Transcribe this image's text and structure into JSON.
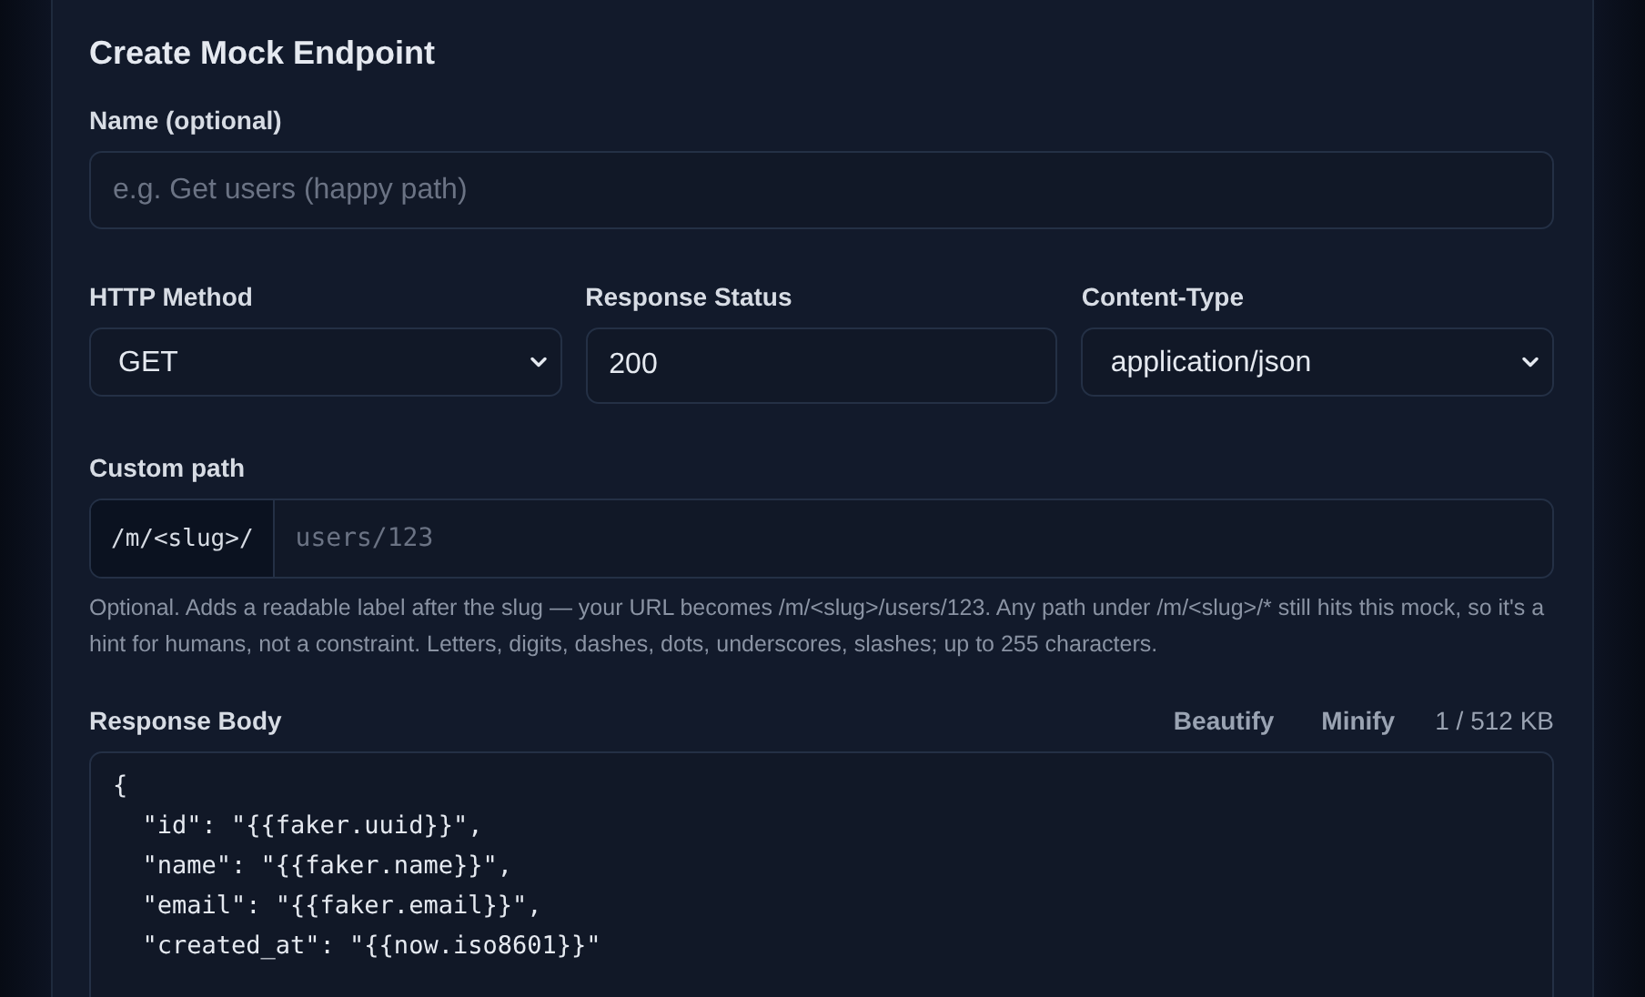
{
  "form": {
    "title": "Create Mock Endpoint",
    "name_field": {
      "label": "Name (optional)",
      "placeholder": "e.g. Get users (happy path)"
    },
    "method": {
      "label": "HTTP Method",
      "value": "GET"
    },
    "status": {
      "label": "Response Status",
      "value": "200"
    },
    "content_type": {
      "label": "Content-Type",
      "value": "application/json"
    },
    "custom_path": {
      "label": "Custom path",
      "prefix": "/m/<slug>/",
      "placeholder": "users/123",
      "help": "Optional. Adds a readable label after the slug — your URL becomes /m/<slug>/users/123. Any path under /m/<slug>/* still hits this mock, so it's a hint for humans, not a constraint. Letters, digits, dashes, dots, underscores, slashes; up to 255 characters."
    },
    "response_body": {
      "label": "Response Body",
      "actions": [
        "Beautify",
        "Minify"
      ],
      "size": "1 / 512 KB",
      "lines": [
        "{",
        "  \"id\": \"{{faker.uuid}}\",",
        "  \"name\": \"{{faker.name}}\",",
        "  \"email\": \"{{faker.email}}\",",
        "  \"created_at\": \"{{now.iso8601}}\""
      ]
    }
  }
}
